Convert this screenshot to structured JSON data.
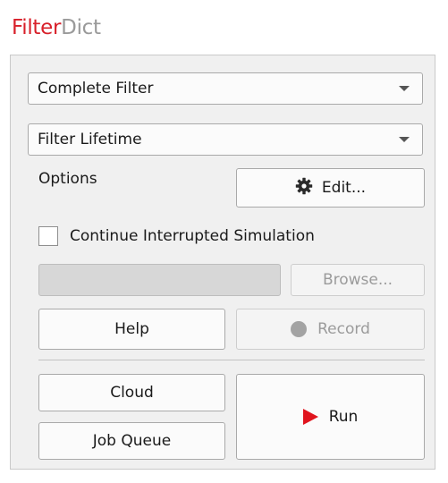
{
  "app": {
    "title_part1": "Filter",
    "title_part2": "Dict"
  },
  "filter_select": {
    "value": "Complete Filter"
  },
  "lifetime_select": {
    "value": "Filter Lifetime"
  },
  "options": {
    "label": "Options",
    "edit_label": "Edit..."
  },
  "continue_sim": {
    "label": "Continue Interrupted Simulation",
    "checked": false
  },
  "path": {
    "value": "",
    "browse_label": "Browse..."
  },
  "buttons": {
    "help": "Help",
    "record": "Record",
    "cloud": "Cloud",
    "job_queue": "Job Queue",
    "run": "Run"
  },
  "icons": {
    "edit": "gear-icon",
    "record": "record-dot-icon",
    "run": "play-icon",
    "combo": "chevron-down-icon"
  },
  "colors": {
    "brand_red": "#d8202a",
    "brand_gray": "#9a9a9a",
    "run_red": "#e0141e",
    "record_gray": "#a3a3a3"
  }
}
